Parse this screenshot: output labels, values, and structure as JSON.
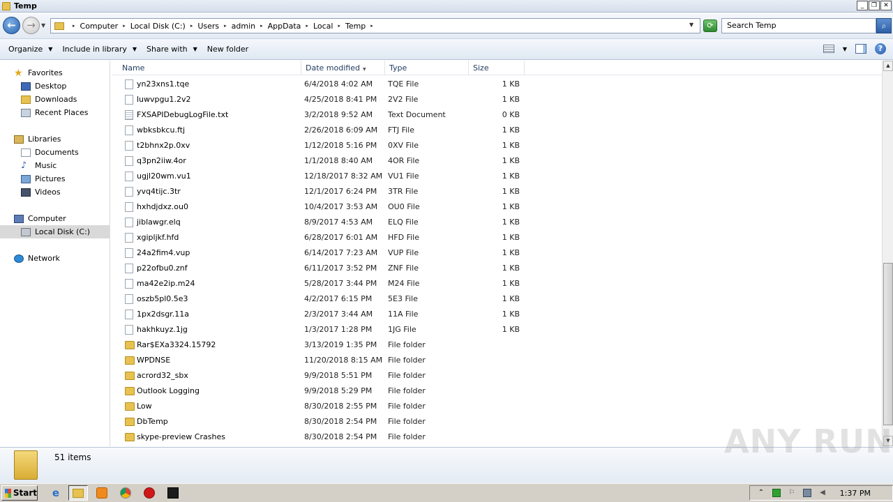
{
  "window": {
    "title": "Temp"
  },
  "titlebar": {
    "min": "_",
    "max": "❐",
    "close": "✕"
  },
  "nav": {
    "back_glyph": "←",
    "fwd_glyph": "→"
  },
  "address": {
    "crumbs": [
      "Computer",
      "Local Disk (C:)",
      "Users",
      "admin",
      "AppData",
      "Local",
      "Temp"
    ]
  },
  "search": {
    "placeholder": "Search Temp"
  },
  "toolbar": {
    "organize": "Organize",
    "include_in_library": "Include in library",
    "share_with": "Share with",
    "new_folder": "New folder"
  },
  "navpane": {
    "favorites": "Favorites",
    "desktop": "Desktop",
    "downloads": "Downloads",
    "recent_places": "Recent Places",
    "libraries": "Libraries",
    "documents": "Documents",
    "music": "Music",
    "pictures": "Pictures",
    "videos": "Videos",
    "computer": "Computer",
    "local_disk": "Local Disk (C:)",
    "network": "Network"
  },
  "columns": {
    "name": "Name",
    "date_modified": "Date modified",
    "type": "Type",
    "size": "Size"
  },
  "files": [
    {
      "name": "yn23xns1.tqe",
      "date": "6/4/2018 4:02 AM",
      "type": "TQE File",
      "size": "1 KB",
      "kind": "file"
    },
    {
      "name": "luwvpgu1.2v2",
      "date": "4/25/2018 8:41 PM",
      "type": "2V2 File",
      "size": "1 KB",
      "kind": "file"
    },
    {
      "name": "FXSAPIDebugLogFile.txt",
      "date": "3/2/2018 9:52 AM",
      "type": "Text Document",
      "size": "0 KB",
      "kind": "txt"
    },
    {
      "name": "wbksbkcu.ftj",
      "date": "2/26/2018 6:09 AM",
      "type": "FTJ File",
      "size": "1 KB",
      "kind": "file"
    },
    {
      "name": "t2bhnx2p.0xv",
      "date": "1/12/2018 5:16 PM",
      "type": "0XV File",
      "size": "1 KB",
      "kind": "file"
    },
    {
      "name": "q3pn2iiw.4or",
      "date": "1/1/2018 8:40 AM",
      "type": "4OR File",
      "size": "1 KB",
      "kind": "file"
    },
    {
      "name": "ugjl20wm.vu1",
      "date": "12/18/2017 8:32 AM",
      "type": "VU1 File",
      "size": "1 KB",
      "kind": "file"
    },
    {
      "name": "yvq4tijc.3tr",
      "date": "12/1/2017 6:24 PM",
      "type": "3TR File",
      "size": "1 KB",
      "kind": "file"
    },
    {
      "name": "hxhdjdxz.ou0",
      "date": "10/4/2017 3:53 AM",
      "type": "OU0 File",
      "size": "1 KB",
      "kind": "file"
    },
    {
      "name": "jiblawgr.elq",
      "date": "8/9/2017 4:53 AM",
      "type": "ELQ File",
      "size": "1 KB",
      "kind": "file"
    },
    {
      "name": "xgipljkf.hfd",
      "date": "6/28/2017 6:01 AM",
      "type": "HFD File",
      "size": "1 KB",
      "kind": "file"
    },
    {
      "name": "24a2fim4.vup",
      "date": "6/14/2017 7:23 AM",
      "type": "VUP File",
      "size": "1 KB",
      "kind": "file"
    },
    {
      "name": "p22ofbu0.znf",
      "date": "6/11/2017 3:52 PM",
      "type": "ZNF File",
      "size": "1 KB",
      "kind": "file"
    },
    {
      "name": "ma42e2ip.m24",
      "date": "5/28/2017 3:44 PM",
      "type": "M24 File",
      "size": "1 KB",
      "kind": "file"
    },
    {
      "name": "oszb5pl0.5e3",
      "date": "4/2/2017 6:15 PM",
      "type": "5E3 File",
      "size": "1 KB",
      "kind": "file"
    },
    {
      "name": "1px2dsgr.11a",
      "date": "2/3/2017 3:44 AM",
      "type": "11A File",
      "size": "1 KB",
      "kind": "file"
    },
    {
      "name": "hakhkuyz.1jg",
      "date": "1/3/2017 1:28 PM",
      "type": "1JG File",
      "size": "1 KB",
      "kind": "file"
    },
    {
      "name": "Rar$EXa3324.15792",
      "date": "3/13/2019 1:35 PM",
      "type": "File folder",
      "size": "",
      "kind": "folder"
    },
    {
      "name": "WPDNSE",
      "date": "11/20/2018 8:15 AM",
      "type": "File folder",
      "size": "",
      "kind": "folder"
    },
    {
      "name": "acrord32_sbx",
      "date": "9/9/2018 5:51 PM",
      "type": "File folder",
      "size": "",
      "kind": "folder"
    },
    {
      "name": "Outlook Logging",
      "date": "9/9/2018 5:29 PM",
      "type": "File folder",
      "size": "",
      "kind": "folder"
    },
    {
      "name": "Low",
      "date": "8/30/2018 2:55 PM",
      "type": "File folder",
      "size": "",
      "kind": "folder"
    },
    {
      "name": "DbTemp",
      "date": "8/30/2018 2:54 PM",
      "type": "File folder",
      "size": "",
      "kind": "folder"
    },
    {
      "name": "skype-preview Crashes",
      "date": "8/30/2018 2:54 PM",
      "type": "File folder",
      "size": "",
      "kind": "folder"
    }
  ],
  "details": {
    "item_count": "51 items"
  },
  "watermark": "ANY RUN",
  "taskbar": {
    "start": "Start",
    "clock": "1:37 PM"
  }
}
